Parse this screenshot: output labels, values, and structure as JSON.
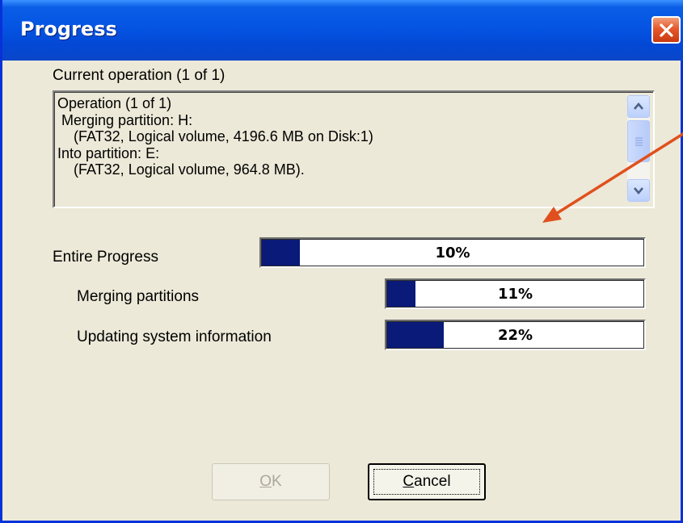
{
  "window": {
    "title": "Progress",
    "close_label": "×"
  },
  "current_operation": {
    "label": "Current operation (1 of 1)",
    "lines": [
      "Operation (1 of 1)",
      " Merging partition: H:",
      "    (FAT32, Logical volume, 4196.6 MB on Disk:1)",
      "Into partition: E:",
      "    (FAT32, Logical volume, 964.8 MB)."
    ]
  },
  "progress": [
    {
      "label": "Entire Progress",
      "percent_text": "10%",
      "fraction": 0.1
    },
    {
      "label": "Merging partitions",
      "percent_text": "11%",
      "fraction": 0.11
    },
    {
      "label": "Updating system information",
      "percent_text": "22%",
      "fraction": 0.22
    }
  ],
  "buttons": {
    "ok_mnemonic": "O",
    "ok_rest": "K",
    "cancel_mnemonic": "C",
    "cancel_rest": "ancel"
  },
  "colors": {
    "title_bar": "#0554e3",
    "progress_fill": "#0a1a78",
    "annotation_arrow": "#e0501e",
    "close_button": "#e5582c"
  },
  "icons": {
    "close": "close-icon",
    "scroll_up": "chevron-up-icon",
    "scroll_down": "chevron-down-icon",
    "annotation": "arrow-annotation-icon"
  }
}
